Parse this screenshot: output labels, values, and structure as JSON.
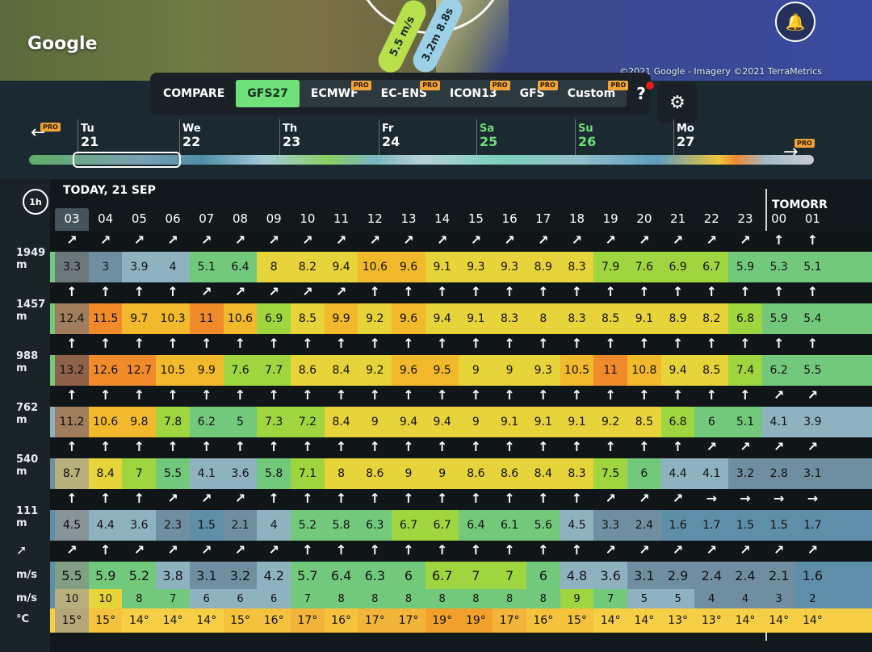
{
  "map": {
    "logo": "Google",
    "attribution": "©2021 Google - Imagery ©2021 TerraMetrics",
    "pill_a": "5.5 m/s",
    "pill_b": "3.2m 8.8s",
    "bell_icon": "bell-icon"
  },
  "compare": {
    "label": "COMPARE",
    "models": [
      {
        "label": "GFS27",
        "active": true,
        "pro": false
      },
      {
        "label": "ECMWF",
        "active": false,
        "pro": true
      },
      {
        "label": "EC-ENS",
        "active": false,
        "pro": true
      },
      {
        "label": "ICON13",
        "active": false,
        "pro": true
      },
      {
        "label": "GFS",
        "active": false,
        "pro": true
      },
      {
        "label": "Custom",
        "active": false,
        "pro": true
      }
    ],
    "pro_badge": "PRO",
    "help": "?"
  },
  "timeline": {
    "days": [
      {
        "name": "Tu",
        "date": "21",
        "weekend": false
      },
      {
        "name": "We",
        "date": "22",
        "weekend": false
      },
      {
        "name": "Th",
        "date": "23",
        "weekend": false
      },
      {
        "name": "Fr",
        "date": "24",
        "weekend": false
      },
      {
        "name": "Sa",
        "date": "25",
        "weekend": true
      },
      {
        "name": "Su",
        "date": "26",
        "weekend": true
      },
      {
        "name": "Mo",
        "date": "27",
        "weekend": false
      }
    ],
    "prev_pro": "PRO",
    "next_pro": "PRO"
  },
  "table": {
    "step_button": "1h",
    "today_label": "TODAY, 21 SEP",
    "tomorrow_label": "TOMORR",
    "hours": [
      "03",
      "04",
      "05",
      "06",
      "07",
      "08",
      "09",
      "10",
      "11",
      "12",
      "13",
      "14",
      "15",
      "16",
      "17",
      "18",
      "19",
      "20",
      "21",
      "22",
      "23",
      "00",
      "01"
    ],
    "altitudes": [
      {
        "label": "1949 m",
        "arrows": "↗↗↗↗↗↗↗↗↗↗↗↗↗↗↗↗↗↗↗↗↗↑↑",
        "values": [
          "3.3",
          "3",
          "3.9",
          "4",
          "5.1",
          "6.4",
          "8",
          "8.2",
          "9.4",
          "10.6",
          "9.6",
          "9.1",
          "9.3",
          "9.3",
          "8.9",
          "8.3",
          "7.9",
          "7.6",
          "6.9",
          "6.7",
          "5.9",
          "5.3",
          "5.1"
        ]
      },
      {
        "label": "1457 m",
        "arrows": "↑↑↑↑↗↗↗↗↗↑↑↑↑↑↑↑↑↑↑↑↑↑↑",
        "values": [
          "12.4",
          "11.5",
          "9.7",
          "10.3",
          "11",
          "10.6",
          "6.9",
          "8.5",
          "9.9",
          "9.2",
          "9.6",
          "9.4",
          "9.1",
          "8.3",
          "8",
          "8.3",
          "8.5",
          "9.1",
          "8.9",
          "8.2",
          "6.8",
          "5.9",
          "5.4"
        ]
      },
      {
        "label": "988 m",
        "arrows": "↑↑↑↑↑↑↑↑↑↑↑↑↑↑↑↑↑↑↑↑↑↑↑",
        "values": [
          "13.2",
          "12.6",
          "12.7",
          "10.5",
          "9.9",
          "7.6",
          "7.7",
          "8.6",
          "8.4",
          "9.2",
          "9.6",
          "9.5",
          "9",
          "9",
          "9.3",
          "10.5",
          "11",
          "10.8",
          "9.4",
          "8.5",
          "7.4",
          "6.2",
          "5.5"
        ]
      },
      {
        "label": "762 m",
        "arrows": "↑↑↑↑↑↑↑↑↑↑↑↑↑↑↑↑↑↑↑↑↑↗↗",
        "values": [
          "11.2",
          "10.6",
          "9.8",
          "7.8",
          "6.2",
          "5",
          "7.3",
          "7.2",
          "8.4",
          "9",
          "9.4",
          "9.4",
          "9",
          "9.1",
          "9.1",
          "9.1",
          "9.2",
          "8.5",
          "6.8",
          "6",
          "5.1",
          "4.1",
          "3.9"
        ]
      },
      {
        "label": "540 m",
        "arrows": "↑↑↑↑↑↑↑↑↑↑↑↑↑↑↑↑↑↑↑↗↗↗↗",
        "values": [
          "8.7",
          "8.4",
          "7",
          "5.5",
          "4.1",
          "3.6",
          "5.8",
          "7.1",
          "8",
          "8.6",
          "9",
          "9",
          "8.6",
          "8.6",
          "8.4",
          "8.3",
          "7.5",
          "6",
          "4.4",
          "4.1",
          "3.2",
          "2.8",
          "3.1"
        ]
      },
      {
        "label": "111 m",
        "arrows": "↑↑↑↗↗↗↑↑↑↑↑↑↑↑↑↑↗↗↗→→→→",
        "values": [
          "4.5",
          "4.4",
          "3.6",
          "2.3",
          "1.5",
          "2.1",
          "4",
          "5.2",
          "5.8",
          "6.3",
          "6.7",
          "6.7",
          "6.4",
          "6.1",
          "5.6",
          "4.5",
          "3.3",
          "2.4",
          "1.6",
          "1.7",
          "1.5",
          "1.5",
          "1.7"
        ]
      }
    ],
    "direction_icon": "compass-icon",
    "surface_arrows": "↗↑↗↗↗↗↗↑↑↑↑↑↑↑↑↑↗↗↗↗↗↗↗",
    "wind_label": "m/s",
    "wind_values": [
      "5.5",
      "5.9",
      "5.2",
      "3.8",
      "3.1",
      "3.2",
      "4.2",
      "5.7",
      "6.4",
      "6.3",
      "6",
      "6.7",
      "7",
      "7",
      "6",
      "4.8",
      "3.6",
      "3.1",
      "2.9",
      "2.4",
      "2.4",
      "2.1",
      "1.6"
    ],
    "gust_label": "m/s",
    "gust_values": [
      "10",
      "10",
      "8",
      "7",
      "6",
      "6",
      "6",
      "7",
      "8",
      "8",
      "8",
      "8",
      "8",
      "8",
      "8",
      "9",
      "7",
      "5",
      "5",
      "4",
      "4",
      "3",
      "2"
    ],
    "temp_label": "°C",
    "temp_values": [
      "15°",
      "15°",
      "14°",
      "14°",
      "14°",
      "15°",
      "16°",
      "17°",
      "16°",
      "17°",
      "17°",
      "19°",
      "19°",
      "17°",
      "16°",
      "15°",
      "14°",
      "14°",
      "13°",
      "13°",
      "14°",
      "14°",
      "14°"
    ]
  }
}
